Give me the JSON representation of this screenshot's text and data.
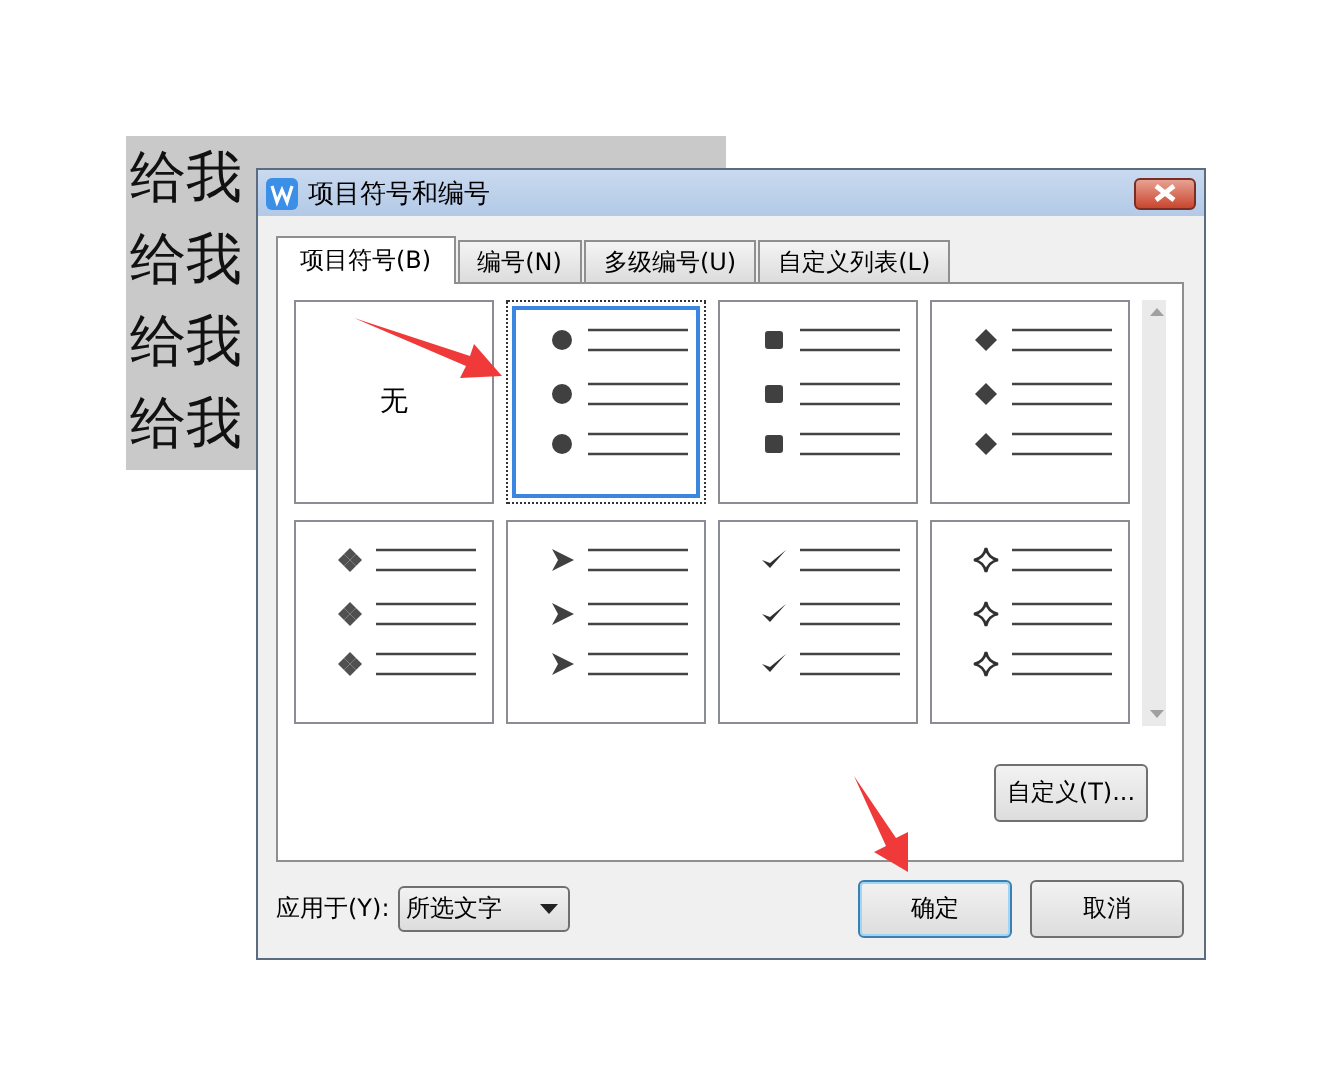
{
  "document": {
    "lines": [
      "给我",
      "给我",
      "给我",
      "给我"
    ]
  },
  "dialog": {
    "title": "项目符号和编号",
    "tabs": [
      {
        "label": "项目符号(B)",
        "selected": true
      },
      {
        "label": "编号(N)",
        "selected": false
      },
      {
        "label": "多级编号(U)",
        "selected": false
      },
      {
        "label": "自定义列表(L)",
        "selected": false
      }
    ],
    "bullets": [
      {
        "kind": "none",
        "label": "无",
        "selected": false
      },
      {
        "kind": "dot",
        "selected": true
      },
      {
        "kind": "square",
        "selected": false
      },
      {
        "kind": "diamond",
        "selected": false
      },
      {
        "kind": "clover",
        "selected": false
      },
      {
        "kind": "arrowhead",
        "selected": false
      },
      {
        "kind": "check",
        "selected": false
      },
      {
        "kind": "star",
        "selected": false
      }
    ],
    "customize_button": "自定义(T)...",
    "apply_to": {
      "label": "应用于(Y):",
      "value": "所选文字"
    },
    "buttons": [
      {
        "label": "确定",
        "default": true
      },
      {
        "label": "取消",
        "default": false
      }
    ]
  }
}
